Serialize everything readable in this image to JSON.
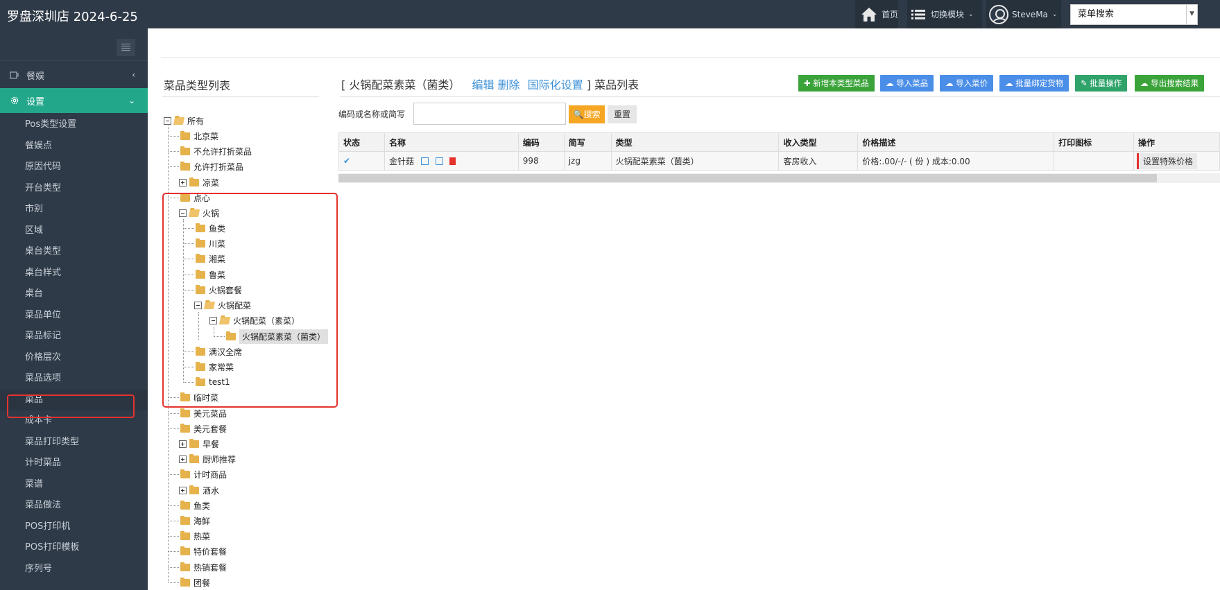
{
  "header": {
    "brand": "罗盘深圳店 2024-6-25",
    "home_label": "首页",
    "switch_label": "切换模块",
    "user_label": "SteveMa",
    "menu_search": "菜单搜索"
  },
  "sidebar": {
    "dining_label": "餐娱",
    "settings_label": "设置",
    "items": [
      "Pos类型设置",
      "餐娱点",
      "原因代码",
      "开台类型",
      "市别",
      "区域",
      "桌台类型",
      "桌台样式",
      "桌台",
      "菜品单位",
      "菜品标记",
      "价格层次",
      "菜品选项",
      "菜品",
      "成本卡",
      "菜品打印类型",
      "计时菜品",
      "菜谱",
      "菜品做法",
      "POS打印机",
      "POS打印模板",
      "序列号"
    ],
    "active_item": "菜品"
  },
  "tree": {
    "title": "菜品类型列表",
    "root": "所有",
    "nodes": [
      "北京菜",
      "不允许打折菜品",
      "允许打折菜品",
      "凉菜",
      "点心",
      "火锅",
      "鱼类",
      "川菜",
      "湘菜",
      "鲁菜",
      "火锅套餐",
      "火锅配菜",
      "火锅配菜（素菜）",
      "火锅配菜素菜（菌类）",
      "满汉全席",
      "家常菜",
      "test1",
      "临时菜",
      "美元菜品",
      "美元套餐",
      "早餐",
      "厨师推荐",
      "计时商品",
      "酒水",
      "鱼类",
      "海鲜",
      "热菜",
      "特价套餐",
      "热销套餐",
      "团餐"
    ]
  },
  "list": {
    "bracket_open": "[ ",
    "category": "火锅配菜素菜（菌类）",
    "edit_link": "编辑",
    "delete_link": "删除",
    "i18n_link": "国际化设置",
    "bracket_close": " ] 菜品列表",
    "buttons": {
      "add": "✚ 新增本类型菜品",
      "import_dish": "☁ 导入菜品",
      "import_price": "☁ 导入菜价",
      "bind_goods": "☁ 批量绑定货物",
      "batch": "✎ 批量操作",
      "export": "☁ 导出搜索结果"
    },
    "search_label": "编码或名称或简写",
    "search_value": "",
    "search_button": "🔍搜索",
    "reset_button": "重置",
    "columns": [
      "状态",
      "名称",
      "编码",
      "简写",
      "类型",
      "收入类型",
      "价格描述",
      "打印图标",
      "操作"
    ],
    "rows": [
      {
        "status": "✔",
        "name": "金针菇",
        "code": "998",
        "abbr": "jzg",
        "type": "火锅配菜素菜（菌类）",
        "income": "客房收入",
        "price_desc": "价格:.00/-/- ( 份 ) 成本:0.00",
        "print_icon": "",
        "action": "设置特殊价格"
      }
    ]
  }
}
